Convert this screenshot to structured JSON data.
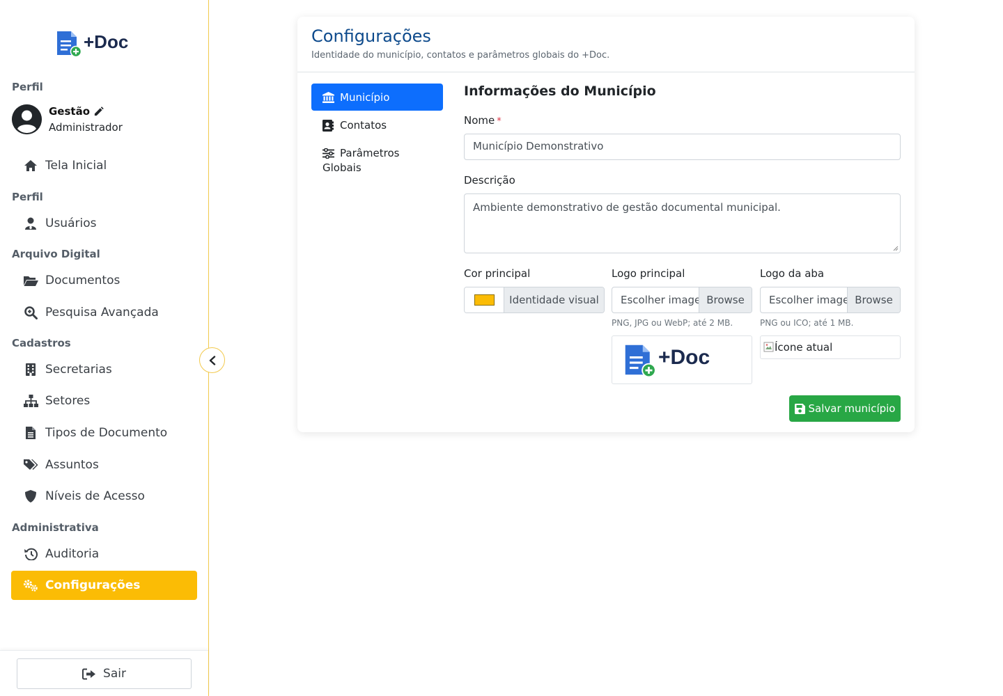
{
  "brand": {
    "name": "+Doc"
  },
  "sidebar": {
    "profile_section": "Perfil",
    "profile": {
      "name": "Gestão",
      "role": "Administrador"
    },
    "home": "Tela Inicial",
    "section_perfil": "Perfil",
    "users": "Usuários",
    "section_arquivo": "Arquivo Digital",
    "documents": "Documentos",
    "advanced_search": "Pesquisa Avançada",
    "section_cadastros": "Cadastros",
    "secretarias": "Secretarias",
    "setores": "Setores",
    "tipos_documento": "Tipos de Documento",
    "assuntos": "Assuntos",
    "niveis_acesso": "Níveis de Acesso",
    "section_administrativa": "Administrativa",
    "auditoria": "Auditoria",
    "configuracoes": "Configurações",
    "logout": "Sair"
  },
  "card": {
    "title": "Configurações",
    "subtitle": "Identidade do município, contatos e parâmetros globais do +Doc."
  },
  "tabs": [
    {
      "label": "Município",
      "active": true
    },
    {
      "label": "Contatos",
      "active": false
    },
    {
      "label": "Parâmetros Globais",
      "active": false
    }
  ],
  "form": {
    "heading": "Informações do Município",
    "name_label": "Nome",
    "required_mark": "*",
    "name_value": "Município Demonstrativo",
    "description_label": "Descrição",
    "description_value": "Ambiente demonstrativo de gestão documental municipal.",
    "color_label": "Cor principal",
    "color_value": "#fbbc05",
    "color_text": "Identidade visual",
    "logo_label": "Logo principal",
    "logo_placeholder": "Escolher imagem",
    "logo_browse": "Browse",
    "logo_hint": "PNG, JPG ou WebP; até 2 MB.",
    "logo_preview_text": "+Doc",
    "favicon_label": "Logo da aba",
    "favicon_placeholder": "Escolher imagem",
    "favicon_browse": "Browse",
    "favicon_hint": "PNG ou ICO; até 1 MB.",
    "favicon_alt": "Ícone atual",
    "save_label": "Salvar município"
  },
  "colors": {
    "accent": "#fbbc05",
    "primary": "#0d6efd",
    "success": "#28a745",
    "title": "#0d4a8c"
  }
}
